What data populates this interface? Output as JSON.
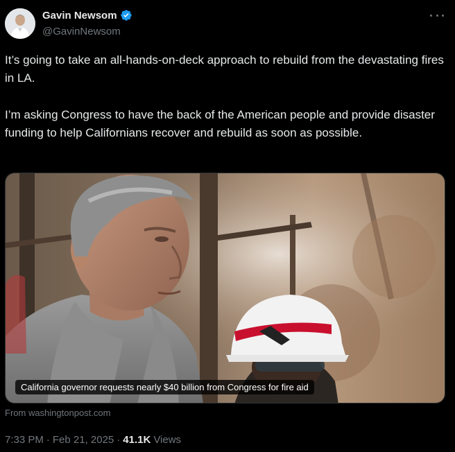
{
  "author": {
    "display_name": "Gavin Newsom",
    "handle": "@GavinNewsom",
    "verified_color": "#1d9bf0"
  },
  "tweet": {
    "paragraphs": [
      "It’s going to take an all-hands-on-deck approach to rebuild from the devastating fires in LA.",
      "I’m asking Congress to have the back of the American people and provide disaster funding to help Californians recover and rebuild as soon as possible."
    ]
  },
  "card": {
    "headline": "California governor requests nearly $40 billion from Congress for fire aid",
    "source": "From washingtonpost.com"
  },
  "meta": {
    "time": "7:33 PM",
    "date": "Feb 21, 2025",
    "separator": "·",
    "views_count": "41.1K",
    "views_label": "Views"
  },
  "icons": {
    "verified": "verified-badge-icon",
    "more": "more-options-icon"
  }
}
